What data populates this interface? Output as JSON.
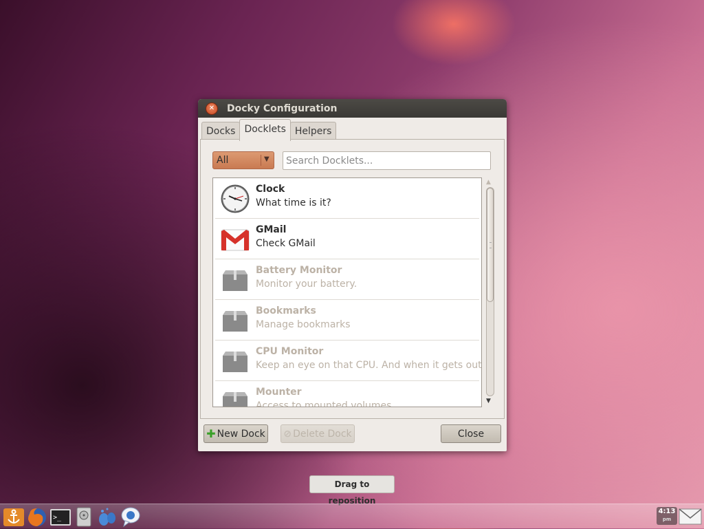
{
  "window": {
    "title": "Docky Configuration",
    "close_icon": "close-icon"
  },
  "tabs": [
    {
      "label": "Docks",
      "active": false
    },
    {
      "label": "Docklets",
      "active": true
    },
    {
      "label": "Helpers",
      "active": false
    }
  ],
  "filter": {
    "selected": "All",
    "accent": "#d08a62"
  },
  "search": {
    "placeholder": "Search Docklets...",
    "value": ""
  },
  "docklets": [
    {
      "name": "Clock",
      "description": "What time is it?",
      "enabled": true,
      "icon": "clock-icon"
    },
    {
      "name": "GMail",
      "description": "Check GMail",
      "enabled": true,
      "icon": "gmail-icon"
    },
    {
      "name": "Battery Monitor",
      "description": "Monitor your battery.",
      "enabled": false,
      "icon": "package-icon"
    },
    {
      "name": "Bookmarks",
      "description": "Manage bookmarks",
      "enabled": false,
      "icon": "package-icon"
    },
    {
      "name": "CPU Monitor",
      "description": "Keep an eye on that CPU. And when it gets out ...",
      "enabled": false,
      "icon": "package-icon"
    },
    {
      "name": "Mounter",
      "description": "Access to mounted volumes",
      "enabled": false,
      "icon": "package-icon"
    }
  ],
  "buttons": {
    "new_dock": "New Dock",
    "delete_dock": "Delete Dock",
    "close": "Close"
  },
  "tooltip": "Drag to reposition",
  "dock": {
    "items": [
      "anchor-icon",
      "firefox-icon",
      "terminal-icon",
      "disk-icon",
      "pidgin-icon",
      "chat-icon"
    ],
    "clock_time": "4:13",
    "clock_suffix": "pm"
  }
}
